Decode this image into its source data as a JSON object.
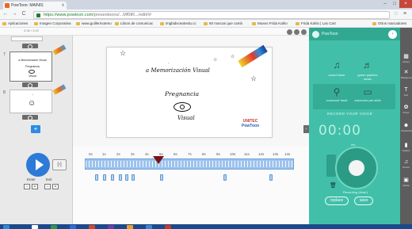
{
  "browser": {
    "tab_title": "PowToon: MAINIS",
    "tab_close": "x",
    "url_host": "https://www.powtoon.com",
    "url_path": "/presentoons/...Mf0tR.../edit/#/",
    "nav_back": "←",
    "nav_forward": "→",
    "nav_reload": "C",
    "window_controls": [
      "–",
      "□",
      "×"
    ],
    "bookmarks": [
      "Aplicaciones",
      "Imagen Corporativa",
      "www.guillermoteno",
      "Libros de comunicac",
      "imgbidsceatredu.cc",
      "50 marcas que camb",
      "Museo Frida Kahlo",
      "Frida Kahlo | Las Cart",
      "Otros marcadores"
    ]
  },
  "app": {
    "zoom_label": "3.96 / 3.00",
    "slide_numbers": [
      "7",
      "8"
    ],
    "add_slide": "+",
    "side_arrow": "›"
  },
  "slides": {
    "thumb1_title": "a Memorización Visual",
    "thumb1_sub1": "Pregnancia",
    "thumb1_sub2": "Visual"
  },
  "canvas": {
    "title": "a Memorización Visual",
    "subtitle": "Pregnancia",
    "caption": "Visual",
    "brand_top": "UNITEC",
    "brand_bottom": "PowToon"
  },
  "timeline": {
    "ruler_labels": [
      "0s",
      "1s",
      "2s",
      "3s",
      "4s",
      "5s",
      "6s",
      "7s",
      "8s",
      "9s",
      "10s",
      "11s",
      "12s",
      "13s",
      "14s"
    ],
    "play_state": "paused",
    "step_label": "[›]",
    "enter_label": "Enter",
    "exit_label": "Exit",
    "enter_values": [
      "–",
      "="
    ],
    "exit_values": [
      "–",
      "="
    ]
  },
  "sound_panel": {
    "header_name": "PowToon",
    "header_toggle": "›",
    "options": [
      {
        "label": "sound track",
        "icon": "music-note-icon"
      },
      {
        "label": "green pipeline music",
        "icon": "music-icon"
      },
      {
        "label": "voiceover track",
        "icon": "microphone-icon"
      },
      {
        "label": "voiceover per slide",
        "icon": "slide-mic-icon"
      }
    ],
    "recorder_title": "RECORD YOUR VOICE",
    "timer": "00:00",
    "record_status": "Recording (timer)",
    "dial_label": "rec",
    "replace_label": "replace",
    "save_label": "save"
  },
  "right_tools": [
    {
      "label": "Library",
      "glyph": "▦"
    },
    {
      "label": "Backgrounds",
      "glyph": "✕"
    },
    {
      "label": "Text",
      "glyph": "T"
    },
    {
      "label": "Props",
      "glyph": "✿"
    },
    {
      "label": "Characters",
      "glyph": "☻"
    },
    {
      "label": "Graphs",
      "glyph": "▮"
    },
    {
      "label": "Sound",
      "glyph": "♫"
    },
    {
      "label": "Media",
      "glyph": "▣"
    }
  ],
  "colors": {
    "sound_panel_bg": "#42bfa8",
    "play_button": "#2d7ad7",
    "timeline_track": "#9dc3ee",
    "playhead": "#7a1316",
    "taskbar": "#1b4a8c"
  }
}
